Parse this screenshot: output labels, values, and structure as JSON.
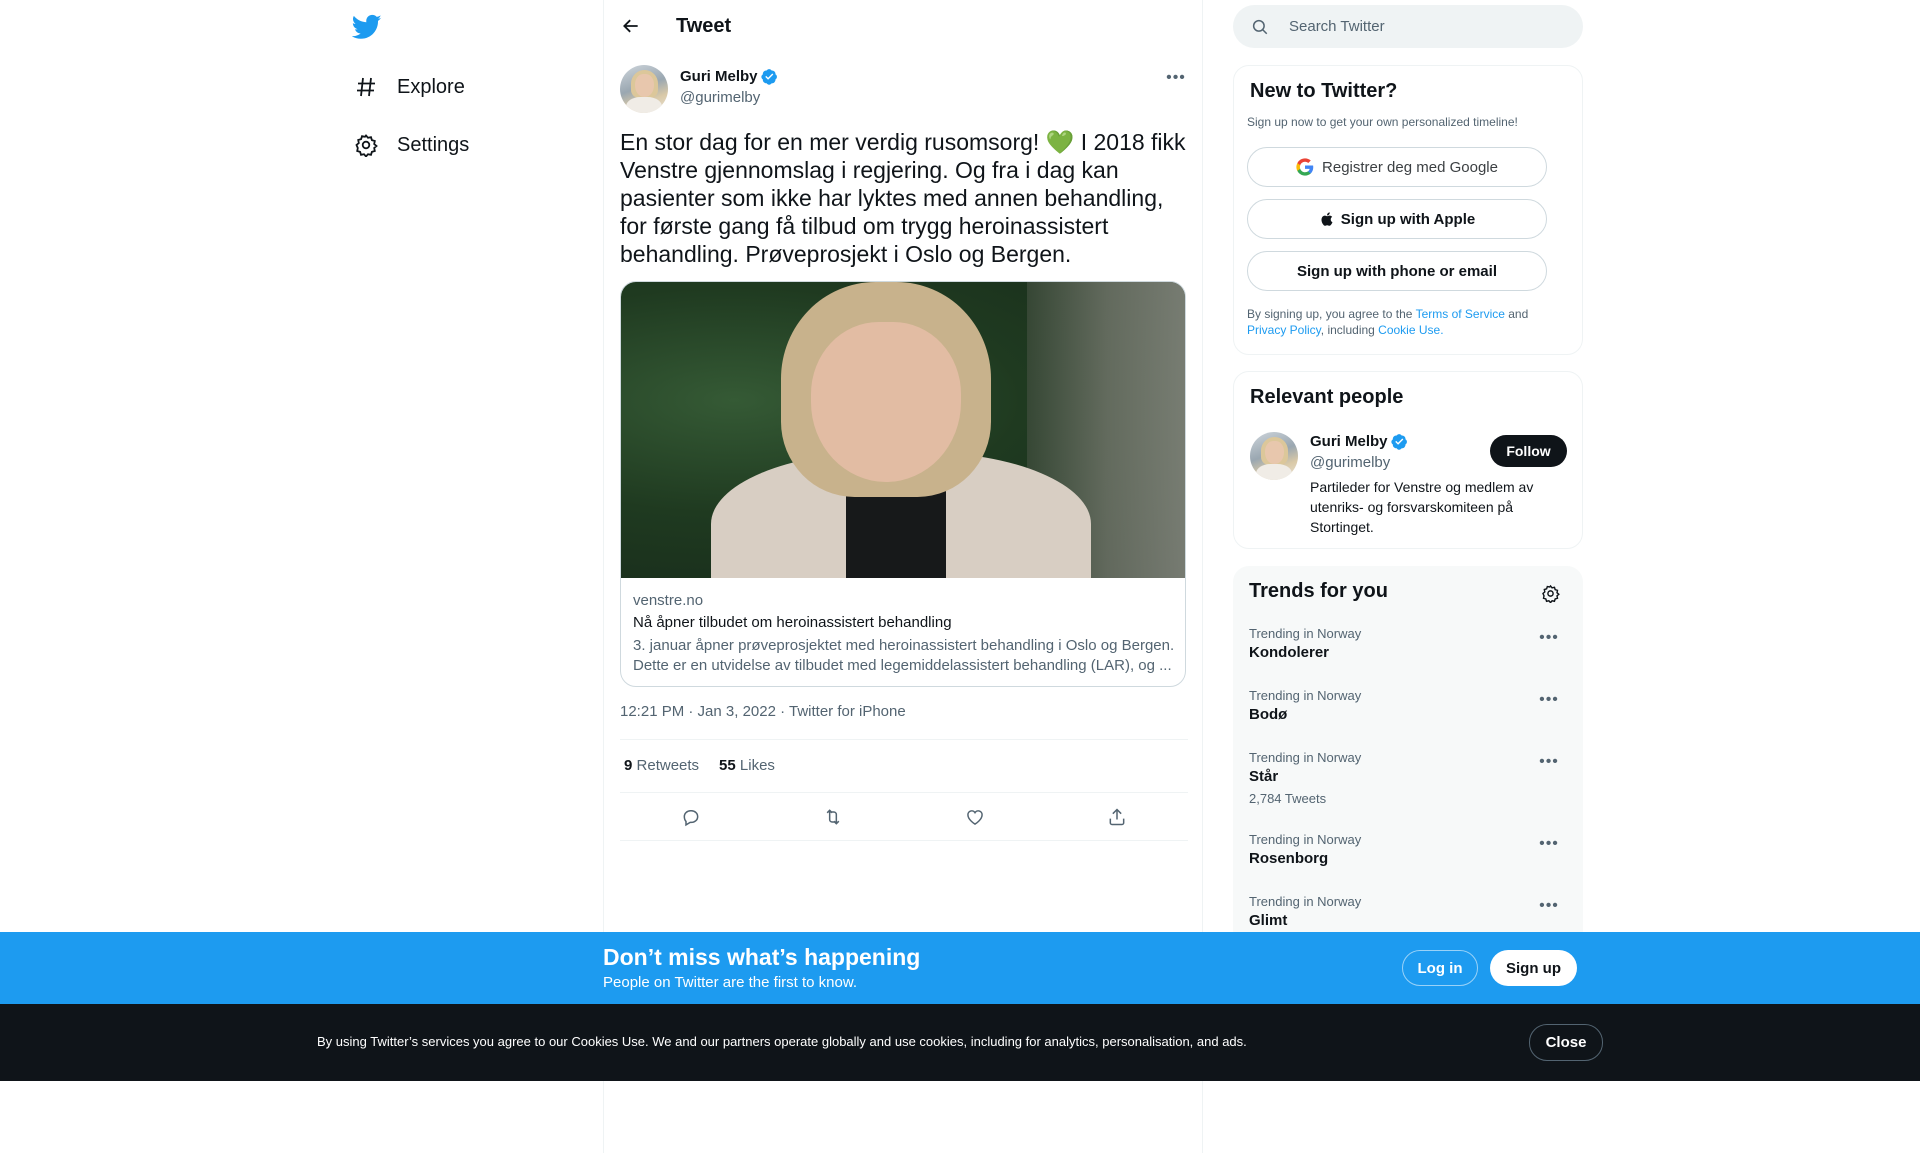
{
  "nav": {
    "logo": "twitter-bird-icon",
    "items": [
      {
        "label": "Explore",
        "icon": "hashtag-icon"
      },
      {
        "label": "Settings",
        "icon": "gear-icon"
      }
    ]
  },
  "header": {
    "title": "Tweet"
  },
  "tweet": {
    "author_name": "Guri Melby",
    "author_handle": "@gurimelby",
    "text": "En stor dag for en mer verdig rusomsorg! 💚 I 2018 fikk Venstre gjennomslag i regjering. Og fra i dag kan pasienter som ikke har lyktes med annen behandling, for første gang få tilbud om trygg heroinassistert behandling. Prøveprosjekt i Oslo og Bergen.",
    "card": {
      "domain": "venstre.no",
      "title": "Nå åpner tilbudet om heroinassistert behandling",
      "description": "3. januar åpner prøveprosjektet med heroinassistert behandling i Oslo og Bergen. Dette er en utvidelse av tilbudet med legemiddelassistert behandling (LAR), og ..."
    },
    "meta": "12:21 PM · Jan 3, 2022 · Twitter for iPhone",
    "retweets_count": "9",
    "retweets_label": "Retweets",
    "likes_count": "55",
    "likes_label": "Likes"
  },
  "search": {
    "placeholder": "Search Twitter"
  },
  "new_to_twitter": {
    "title": "New to Twitter?",
    "subtitle": "Sign up now to get your own personalized timeline!",
    "google_button": "Registrer deg med Google",
    "apple_button": "Sign up with Apple",
    "phone_button": "Sign up with phone or email",
    "terms_prefix": "By signing up, you agree to the ",
    "terms_link": "Terms of Service",
    "terms_and": " and",
    "privacy_link": "Privacy Policy",
    "including": ", including ",
    "cookie_link": "Cookie Use."
  },
  "relevant_people": {
    "title": "Relevant people",
    "name": "Guri Melby",
    "handle": "@gurimelby",
    "follow_label": "Follow",
    "bio": "Partileder for Venstre og medlem av utenriks- og forsvarskomiteen på Stortinget."
  },
  "trends": {
    "title": "Trends for you",
    "items": [
      {
        "context": "Trending in Norway",
        "name": "Kondolerer",
        "count": ""
      },
      {
        "context": "Trending in Norway",
        "name": "Bodø",
        "count": ""
      },
      {
        "context": "Trending in Norway",
        "name": "Står",
        "count": "2,784 Tweets"
      },
      {
        "context": "Trending in Norway",
        "name": "Rosenborg",
        "count": ""
      },
      {
        "context": "Trending in Norway",
        "name": "Glimt",
        "count": ""
      }
    ]
  },
  "signup_bar": {
    "title": "Don’t miss what’s happening",
    "subtitle": "People on Twitter are the first to know.",
    "login_label": "Log in",
    "signup_label": "Sign up"
  },
  "cookie_bar": {
    "text": "By using Twitter’s services you agree to our Cookies Use. We and our partners operate globally and use cookies, including for analytics, personalisation, and ads.",
    "close_label": "Close"
  },
  "colors": {
    "accent": "#1d9bf0",
    "text": "#0f1419",
    "secondary": "#536471",
    "dark": "#0f1419"
  }
}
